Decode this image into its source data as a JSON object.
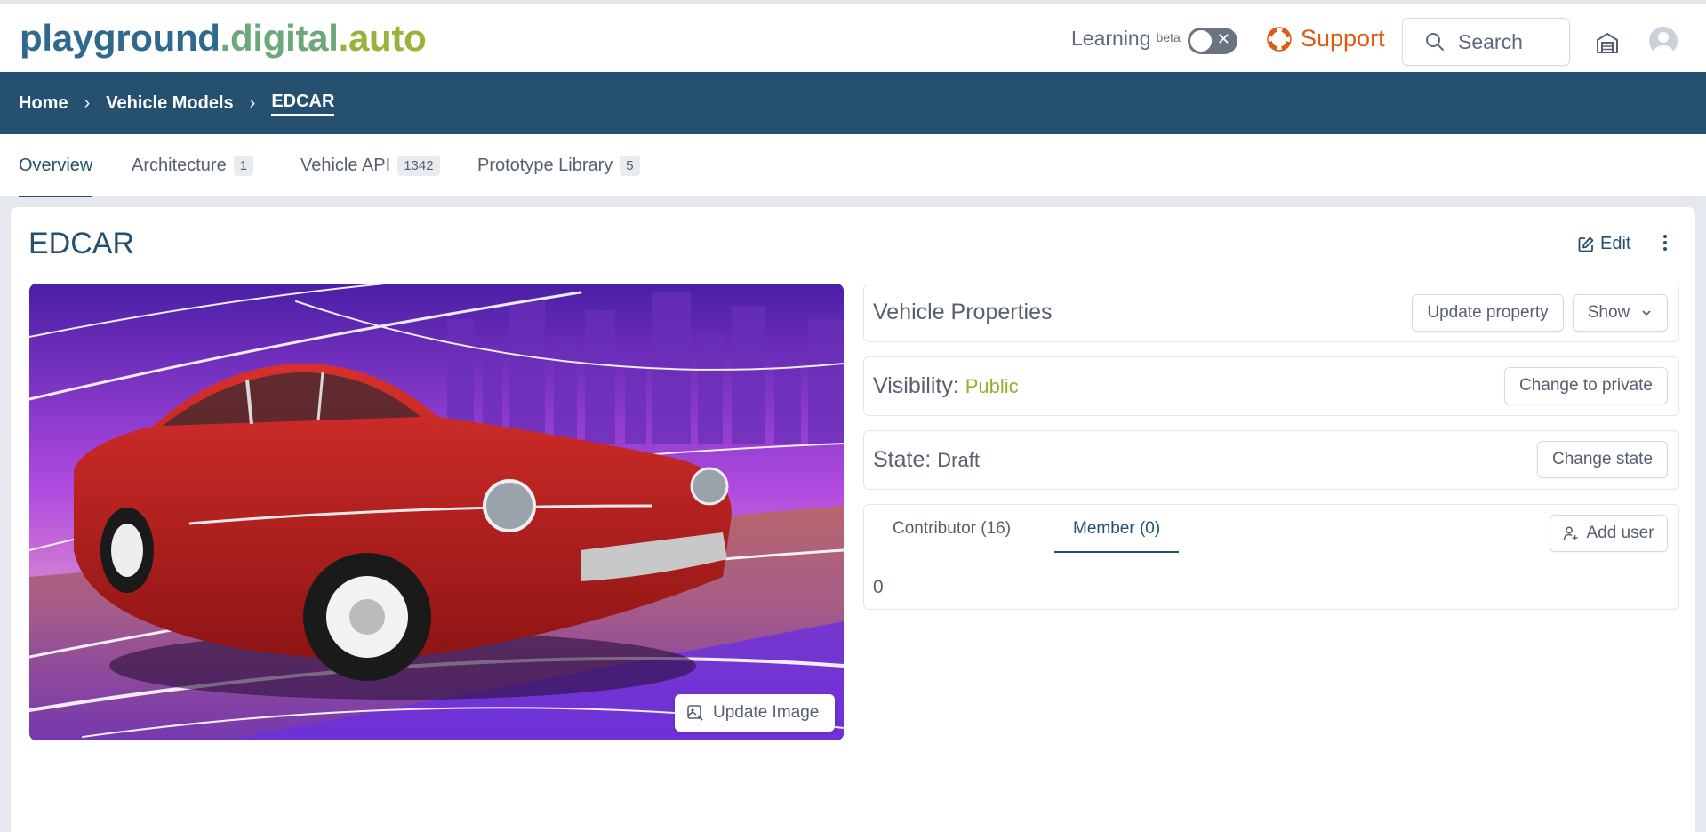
{
  "header": {
    "logo": {
      "part1": "playground",
      "part2": ".digital",
      "part3": ".auto"
    },
    "learning_label": "Learning",
    "beta_label": "beta",
    "support_label": "Support",
    "search_placeholder": "Search"
  },
  "breadcrumb": [
    {
      "label": "Home"
    },
    {
      "label": "Vehicle Models"
    },
    {
      "label": "EDCAR"
    }
  ],
  "tabs": [
    {
      "label": "Overview",
      "count": ""
    },
    {
      "label": "Architecture",
      "count": "1"
    },
    {
      "label": "Vehicle API",
      "count": "1342"
    },
    {
      "label": "Prototype Library",
      "count": "5"
    }
  ],
  "model": {
    "name": "EDCAR",
    "edit_label": "Edit",
    "update_image_label": "Update Image"
  },
  "properties": {
    "title": "Vehicle Properties",
    "update_label": "Update property",
    "show_label": "Show"
  },
  "visibility": {
    "label": "Visibility:",
    "value": "Public",
    "action": "Change to private"
  },
  "state": {
    "label": "State:",
    "value": "Draft",
    "action": "Change state"
  },
  "members": {
    "tabs": [
      {
        "label": "Contributor (16)"
      },
      {
        "label": "Member (0)"
      }
    ],
    "add_user_label": "Add user",
    "content": "0"
  },
  "colors": {
    "brand_navy": "#26506f",
    "support_orange": "#e05a12",
    "public_green": "#8fb22a"
  }
}
